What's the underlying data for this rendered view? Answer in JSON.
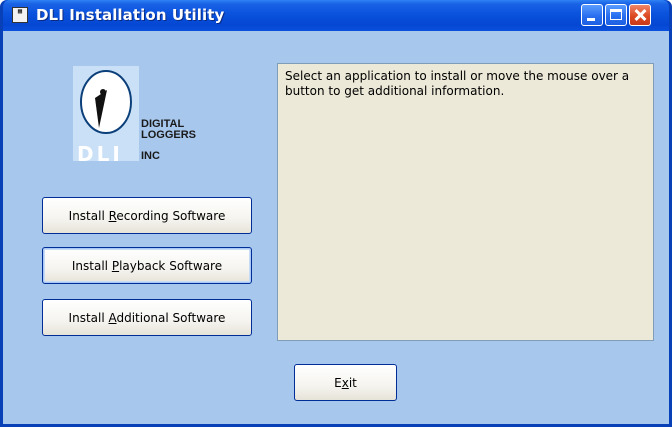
{
  "window": {
    "title": "DLI Installation Utility",
    "icon": "app-disk-icon"
  },
  "titlebar_buttons": {
    "minimize": "minimize-icon",
    "maximize": "maximize-icon",
    "close": "close-icon"
  },
  "logo": {
    "line1": "DIGITAL",
    "line2": "LOGGERS",
    "line3": "INC",
    "mark": "DLI"
  },
  "buttons": {
    "recording": {
      "pre": "Install ",
      "accel": "R",
      "post": "ecording Software"
    },
    "playback": {
      "pre": "Install ",
      "accel": "P",
      "post": "layback Software"
    },
    "additional": {
      "pre": "Install ",
      "accel": "A",
      "post": "dditional Software"
    },
    "exit": {
      "pre": "E",
      "accel": "x",
      "post": "it"
    }
  },
  "info_panel": {
    "text": "Select an application to install or move the mouse over a button to get additional information."
  },
  "colors": {
    "titlebar": "#0a52dd",
    "client_background": "#a7c7ec",
    "panel_background": "#ece9d8",
    "button_border": "#002d96"
  }
}
